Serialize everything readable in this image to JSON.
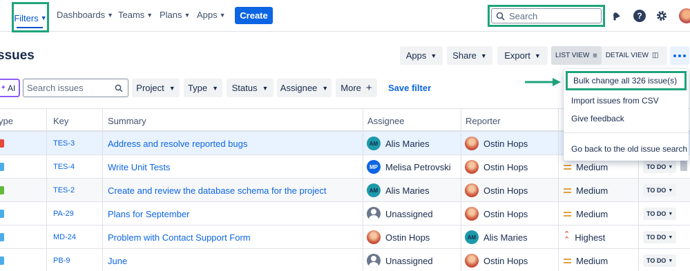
{
  "nav": {
    "items": [
      {
        "label": "Filters",
        "active": true
      },
      {
        "label": "Dashboards"
      },
      {
        "label": "Teams"
      },
      {
        "label": "Plans"
      },
      {
        "label": "Apps"
      }
    ],
    "create_label": "Create",
    "search_placeholder": "Search",
    "icons": [
      "notification-bell-icon",
      "help-icon",
      "settings-gear-icon",
      "profile-avatar"
    ]
  },
  "header": {
    "title": "ssues",
    "buttons": {
      "apps": "Apps",
      "share": "Share",
      "export": "Export"
    },
    "view": {
      "list": "LIST VIEW",
      "detail": "DETAIL VIEW",
      "active": "list"
    }
  },
  "filters": {
    "ai_label": "AI",
    "search_placeholder": "Search issues",
    "project": "Project",
    "type": "Type",
    "status": "Status",
    "assignee": "Assignee",
    "more": "More",
    "save": "Save filter"
  },
  "table": {
    "columns": {
      "type": "ype",
      "key": "Key",
      "summary": "Summary",
      "assignee": "Assignee",
      "reporter": "Reporter"
    },
    "rows": [
      {
        "type_color": "#e5493a",
        "key": "TES-3",
        "summary": "Address and resolve reported bugs",
        "assignee": "Alis Maries",
        "assignee_av": "AM",
        "reporter": "Ostin Hops",
        "reporter_av": "photo",
        "priority": "",
        "status": ""
      },
      {
        "type_color": "#4bade8",
        "key": "TES-4",
        "summary": "Write Unit Tests",
        "assignee": "Melisa Petrovski",
        "assignee_av": "MP",
        "reporter": "Ostin Hops",
        "reporter_av": "photo",
        "priority": "Medium",
        "status": "TO DO"
      },
      {
        "type_color": "#63ba3c",
        "key": "TES-2",
        "summary": "Create and review the database schema for the project",
        "assignee": "Alis Maries",
        "assignee_av": "AM",
        "reporter": "Ostin Hops",
        "reporter_av": "photo",
        "priority": "Medium",
        "status": "TO DO"
      },
      {
        "type_color": "#4bade8",
        "key": "PA-29",
        "summary": "Plans for September",
        "assignee": "Unassigned",
        "assignee_av": "unassigned",
        "reporter": "Ostin Hops",
        "reporter_av": "photo",
        "priority": "Medium",
        "status": "TO DO"
      },
      {
        "type_color": "#4bade8",
        "key": "MD-24",
        "summary": "Problem with Contact Support Form",
        "assignee": "Ostin Hops",
        "assignee_av": "photo",
        "reporter": "Alis Maries",
        "reporter_av": "AM",
        "priority": "Highest",
        "status": "TO DO"
      },
      {
        "type_color": "#4bade8",
        "key": "PB-9",
        "summary": "June",
        "assignee": "Unassigned",
        "assignee_av": "unassigned",
        "reporter": "Ostin Hops",
        "reporter_av": "photo",
        "priority": "Medium",
        "status": "TO DO"
      }
    ]
  },
  "menu": {
    "items": [
      "Bulk change all 326 issue(s)",
      "Import issues from CSV",
      "Give feedback",
      "Go back to the old issue search"
    ]
  },
  "colors": {
    "highlight": "#1fa37a",
    "brand": "#0c66e4",
    "link": "#0c66e4"
  }
}
